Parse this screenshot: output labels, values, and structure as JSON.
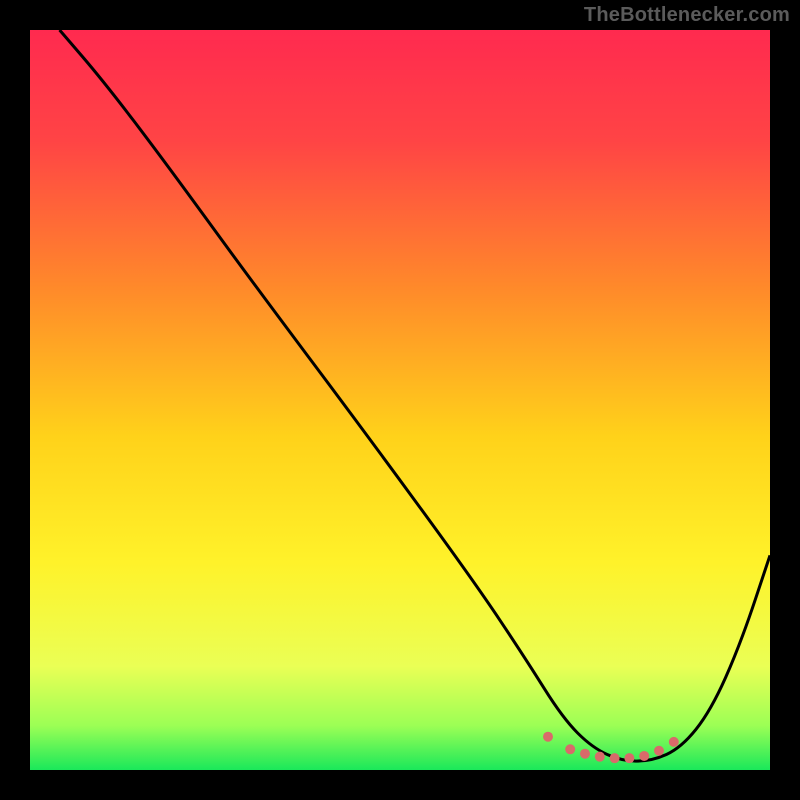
{
  "watermark": "TheBottlenecker.com",
  "chart_data": {
    "type": "line",
    "title": "",
    "xlabel": "",
    "ylabel": "",
    "xlim": [
      0,
      100
    ],
    "ylim": [
      0,
      100
    ],
    "gradient_stops": [
      {
        "offset": 0.0,
        "color": "#ff2a4f"
      },
      {
        "offset": 0.15,
        "color": "#ff4445"
      },
      {
        "offset": 0.35,
        "color": "#ff8a2a"
      },
      {
        "offset": 0.55,
        "color": "#ffd21a"
      },
      {
        "offset": 0.72,
        "color": "#fff22a"
      },
      {
        "offset": 0.86,
        "color": "#eaff55"
      },
      {
        "offset": 0.94,
        "color": "#9cff55"
      },
      {
        "offset": 1.0,
        "color": "#1ae85a"
      }
    ],
    "series": [
      {
        "name": "bottleneck-curve",
        "color": "#000000",
        "x": [
          4,
          10,
          18,
          30,
          45,
          60,
          67,
          72,
          76,
          80,
          84,
          88,
          92,
          96,
          100
        ],
        "y": [
          100,
          93,
          82.5,
          66,
          46,
          25.5,
          15,
          7,
          3,
          1.2,
          1.2,
          3,
          8,
          17,
          29
        ]
      }
    ],
    "flat_highlight": {
      "name": "optimal-range-dots",
      "color": "#d96a6a",
      "points": [
        {
          "x": 70,
          "y": 4.5
        },
        {
          "x": 73,
          "y": 2.8
        },
        {
          "x": 75,
          "y": 2.2
        },
        {
          "x": 77,
          "y": 1.8
        },
        {
          "x": 79,
          "y": 1.6
        },
        {
          "x": 81,
          "y": 1.6
        },
        {
          "x": 83,
          "y": 1.9
        },
        {
          "x": 85,
          "y": 2.6
        },
        {
          "x": 87,
          "y": 3.8
        }
      ],
      "radius": 5
    }
  }
}
